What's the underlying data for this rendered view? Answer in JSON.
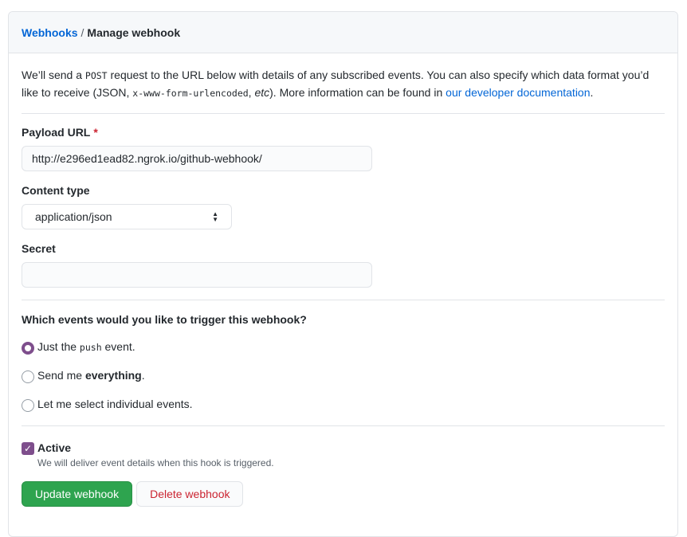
{
  "breadcrumb": {
    "parent": "Webhooks",
    "separator": "/",
    "current": "Manage webhook"
  },
  "intro": {
    "part1": "We’ll send a ",
    "method": "POST",
    "part2": " request to the URL below with details of any subscribed events. You can also specify which data format you’d like to receive (JSON, ",
    "format": "x-www-form-urlencoded",
    "part3": ", ",
    "etc": "etc",
    "part4": "). More information can be found in ",
    "link": "our developer documentation",
    "part5": "."
  },
  "payload_url": {
    "label": "Payload URL",
    "required_mark": "*",
    "value": "http://e296ed1ead82.ngrok.io/github-webhook/"
  },
  "content_type": {
    "label": "Content type",
    "value": "application/json"
  },
  "secret": {
    "label": "Secret",
    "value": ""
  },
  "events": {
    "title": "Which events would you like to trigger this webhook?",
    "options": [
      {
        "pre": "Just the ",
        "code": "push",
        "post": " event.",
        "selected": true
      },
      {
        "pre": "Send me ",
        "bold": "everything",
        "post": ".",
        "selected": false
      },
      {
        "text": "Let me select individual events.",
        "selected": false
      }
    ]
  },
  "active": {
    "label": "Active",
    "checked": true,
    "note": "We will deliver event details when this hook is triggered."
  },
  "buttons": {
    "update": "Update webhook",
    "delete": "Delete webhook"
  },
  "colors": {
    "link": "#0366d6",
    "primary": "#2ea44f",
    "danger": "#cb2431",
    "accent": "#7e4e8c"
  }
}
